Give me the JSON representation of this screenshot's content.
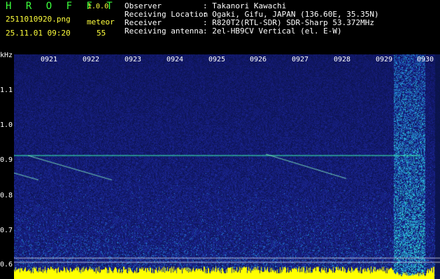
{
  "app": {
    "logo": "H R O F F T",
    "version": "1.0.0"
  },
  "file": {
    "name": "2511010920.png",
    "datetime": "25.11.01 09:20"
  },
  "meteor": {
    "label": "meteor",
    "count": "55"
  },
  "station": [
    {
      "label": "Observer",
      "value": ": Takanori Kawachi"
    },
    {
      "label": "Receiving Location",
      "value": ": Ogaki, Gifu, JAPAN (136.60E, 35.35N)"
    },
    {
      "label": "Receiver",
      "value": ": R820T2(RTL-SDR) SDR-Sharp 53.372MHz"
    },
    {
      "label": "Receiving antenna",
      "value": ": 2el-HB9CV Vertical (el. E-W)"
    }
  ],
  "axis": {
    "unit": "kHz",
    "time_ticks": [
      "0921",
      "0922",
      "0923",
      "0924",
      "0925",
      "0926",
      "0927",
      "0928",
      "0929",
      "0930"
    ],
    "freq_ticks": [
      {
        "label": "1.1",
        "value": 1.1
      },
      {
        "label": "1.0",
        "value": 1.0
      },
      {
        "label": "0.9",
        "value": 0.9
      },
      {
        "label": "0.8",
        "value": 0.8
      },
      {
        "label": "0.7",
        "value": 0.7
      },
      {
        "label": "0.6",
        "value": 0.6
      }
    ]
  },
  "colors": {
    "header_green": "#3cff3c",
    "header_yellow": "#ffff3c",
    "noise_base": "#1a2a9a",
    "carrier": "#3dffb0",
    "level_bar": "#ffff00"
  }
}
